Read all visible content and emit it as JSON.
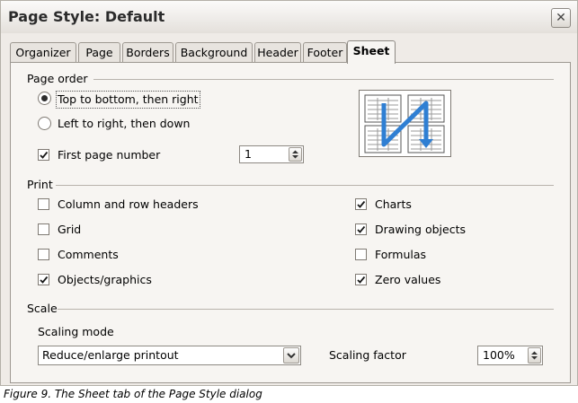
{
  "dialog": {
    "title": "Page Style: Default",
    "close_glyph": "✕"
  },
  "tabs": [
    {
      "label": "Organizer",
      "active": false
    },
    {
      "label": "Page",
      "active": false
    },
    {
      "label": "Borders",
      "active": false
    },
    {
      "label": "Background",
      "active": false
    },
    {
      "label": "Header",
      "active": false
    },
    {
      "label": "Footer",
      "active": false
    },
    {
      "label": "Sheet",
      "active": true
    }
  ],
  "page_order": {
    "section_label": "Page order",
    "top_to_bottom": {
      "label": "Top to bottom, then right",
      "selected": true
    },
    "left_to_right": {
      "label": "Left to right, then down",
      "selected": false
    },
    "first_page_number": {
      "label": "First page number",
      "checked": true,
      "value": "1"
    },
    "preview_icon": "page-order-preview-icon"
  },
  "print": {
    "section_label": "Print",
    "column_row_headers": {
      "label": "Column and row headers",
      "checked": false
    },
    "grid": {
      "label": "Grid",
      "checked": false
    },
    "comments": {
      "label": "Comments",
      "checked": false
    },
    "objects_graphics": {
      "label": "Objects/graphics",
      "checked": true
    },
    "charts": {
      "label": "Charts",
      "checked": true
    },
    "drawing_objects": {
      "label": "Drawing objects",
      "checked": true
    },
    "formulas": {
      "label": "Formulas",
      "checked": false
    },
    "zero_values": {
      "label": "Zero values",
      "checked": true
    }
  },
  "scale": {
    "section_label": "Scale",
    "scaling_mode_label": "Scaling mode",
    "scaling_mode_value": "Reduce/enlarge printout",
    "scaling_factor_label": "Scaling factor",
    "scaling_factor_value": "100%"
  },
  "caption": "Figure 9. The Sheet tab of the Page Style dialog",
  "colors": {
    "dialog_bg": "#efebe7",
    "panel_bg": "#f7f5f2",
    "accent_arrow": "#2f7fd3"
  }
}
